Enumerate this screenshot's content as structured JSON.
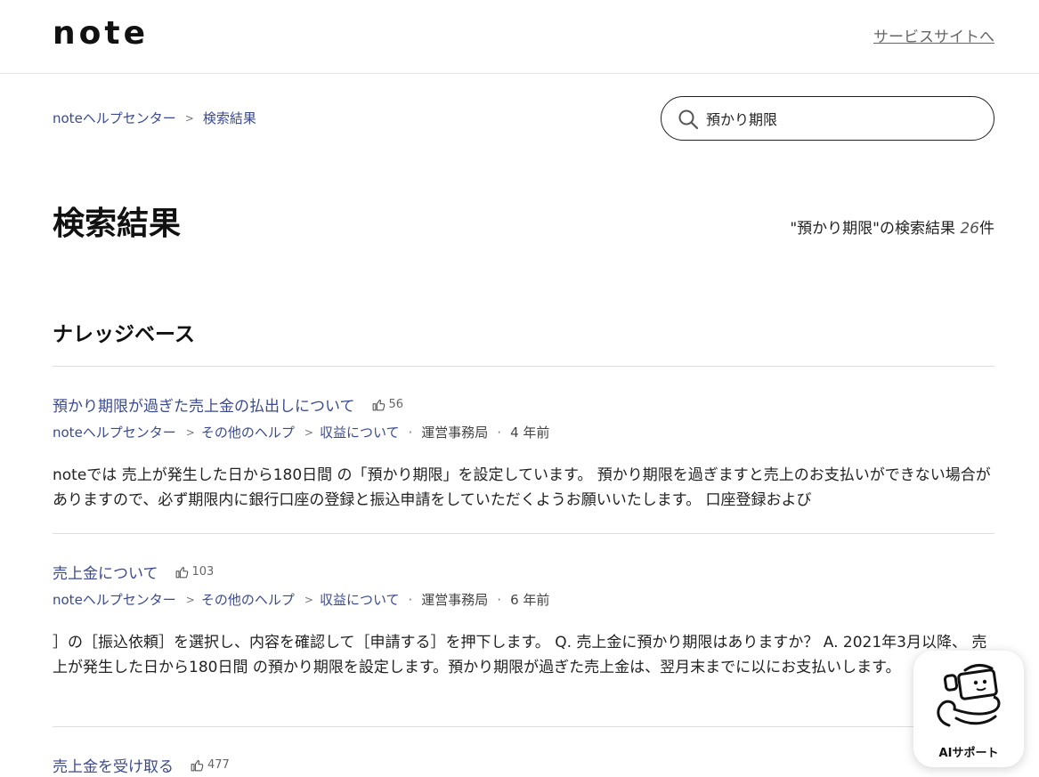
{
  "header": {
    "logo": "note",
    "service_link": "サービスサイトへ"
  },
  "breadcrumb": {
    "home": "noteヘルプセンター",
    "sep": ">",
    "current": "検索結果"
  },
  "search": {
    "value": "預かり期限"
  },
  "page": {
    "title": "検索結果",
    "count_prefix": "\"預かり期限\"の検索結果 ",
    "count": "26",
    "count_suffix": "件"
  },
  "section": {
    "title": "ナレッジベース"
  },
  "results": [
    {
      "title": "預かり期限が過ぎた売上金の払出しについて",
      "votes": "56",
      "crumb1": "noteヘルプセンター",
      "crumb2": "その他のヘルプ",
      "crumb3": "収益について",
      "author": "運営事務局",
      "age": "4 年前",
      "snippet": "noteでは 売上が発生した日から180日間 の「預かり期限」を設定しています。 預かり期限を過ぎますと売上のお支払いができない場合がありますので、必ず期限内に銀行口座の登録と振込申請をしていただくようお願いいたします。 口座登録および"
    },
    {
      "title": "売上金について",
      "votes": "103",
      "crumb1": "noteヘルプセンター",
      "crumb2": "その他のヘルプ",
      "crumb3": "収益について",
      "author": "運営事務局",
      "age": "6 年前",
      "snippet": "］の［振込依頼］を選択し、内容を確認して［申請する］を押下します。 Q. 売上金に預かり期限はありますか？ A. 2021年3月以降、 売上が発生した日から180日間 の預かり期限を設定します。預かり期限が過ぎた売上金は、翌月末までに以にお支払いします。"
    },
    {
      "title": "売上金を受け取る",
      "votes": "477"
    }
  ],
  "ai_support": {
    "label": "AIサポート"
  },
  "colors": {
    "link": "#3b4a8f",
    "text": "#1a1a1a",
    "divider": "#dedede"
  }
}
